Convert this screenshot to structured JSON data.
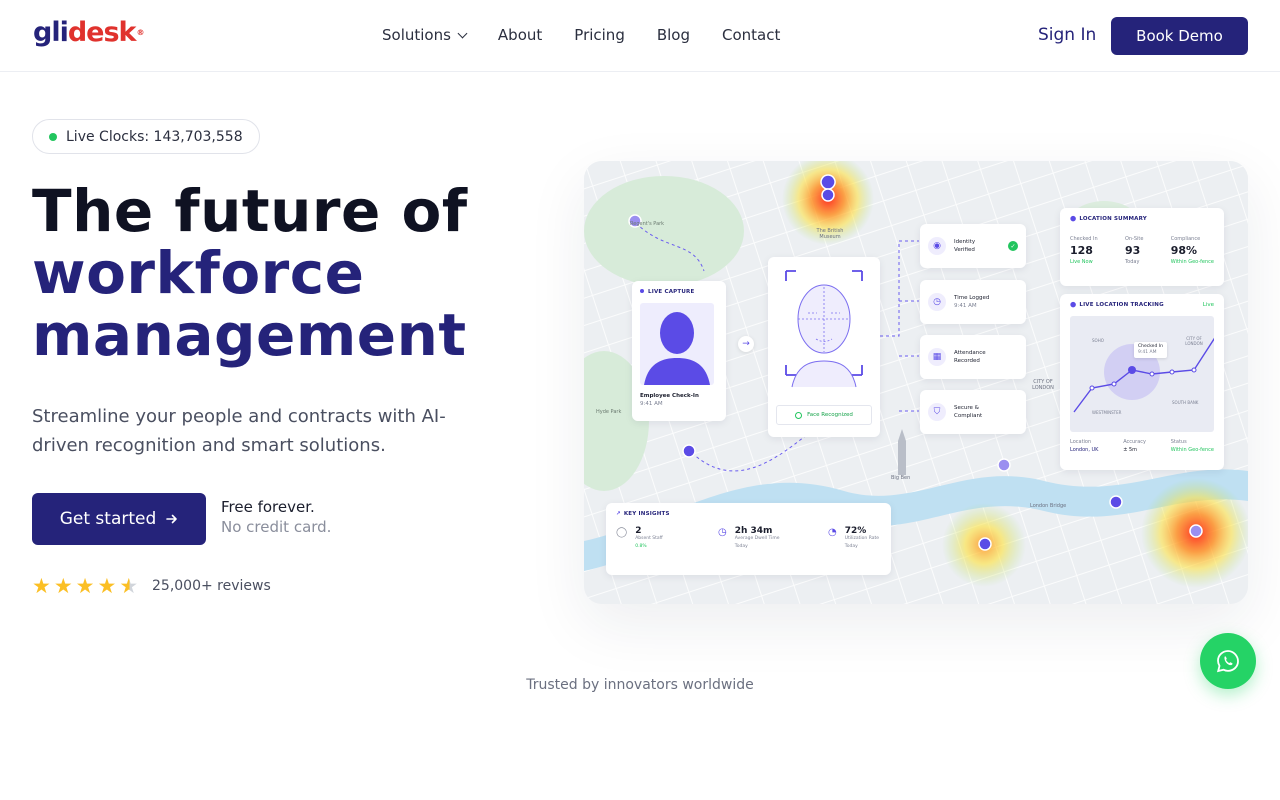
{
  "brand": {
    "part1": "gli",
    "part2": "desk",
    "mark": "®"
  },
  "nav": {
    "items": [
      {
        "label": "Solutions",
        "has_dropdown": true
      },
      {
        "label": "About"
      },
      {
        "label": "Pricing"
      },
      {
        "label": "Blog"
      },
      {
        "label": "Contact"
      }
    ],
    "sign_in": "Sign In",
    "book_demo": "Book Demo"
  },
  "hero": {
    "live_clocks": "Live Clocks: 143,703,558",
    "title_line1": "The future of",
    "title_line2": "workforce",
    "title_line3": "management",
    "subtitle": "Streamline your people and contracts with AI-driven recognition and smart solutions.",
    "cta_label": "Get started",
    "free_line1": "Free forever.",
    "free_line2": "No credit card.",
    "rating_stars": 4.5,
    "reviews": "25,000+ reviews"
  },
  "dashboard": {
    "map_labels": {
      "park": "Regent's Park",
      "museum": "The British Museum",
      "city": "CITY OF LONDON",
      "hyde": "Hyde Park",
      "bigben": "Big Ben",
      "bridge": "London Bridge"
    },
    "live_capture": {
      "title": "LIVE CAPTURE",
      "name": "Employee Check-In",
      "time": "9:41 AM"
    },
    "face": {
      "status": "Face Recognized"
    },
    "steps": [
      {
        "title": "Identity",
        "sub": "Verified"
      },
      {
        "title": "Time Logged",
        "sub": "9:41 AM"
      },
      {
        "title": "Attendance",
        "sub": "Recorded"
      },
      {
        "title": "Secure &",
        "sub": "Compliant"
      }
    ],
    "location_summary": {
      "title": "LOCATION SUMMARY",
      "stats": [
        {
          "label": "Checked In",
          "value": "128",
          "note": "Live Now"
        },
        {
          "label": "On-Site",
          "value": "93",
          "note": "Today"
        },
        {
          "label": "Compliance",
          "value": "98%",
          "note": "Within Geo-fence"
        }
      ]
    },
    "tracking": {
      "title": "LIVE LOCATION TRACKING",
      "live": "Live",
      "popup_title": "Checked In",
      "popup_time": "9:41 AM",
      "areas": [
        "SOHO",
        "CITY OF LONDON",
        "WESTMINSTER",
        "SOUTH BANK"
      ],
      "footer": [
        {
          "label": "Location",
          "value": "London, UK"
        },
        {
          "label": "Accuracy",
          "value": "± 5m"
        },
        {
          "label": "Status",
          "value": "Within Geo-fence"
        }
      ]
    },
    "insights": {
      "title": "KEY INSIGHTS",
      "items": [
        {
          "value": "2",
          "label": "Absent Staff",
          "note": "0.8%"
        },
        {
          "value": "2h 34m",
          "label": "Average Dwell Time",
          "note": "Today"
        },
        {
          "value": "72%",
          "label": "Utilization Rate",
          "note": "Today"
        }
      ]
    }
  },
  "trusted": "Trusted by innovators worldwide",
  "colors": {
    "brand": "#25237a",
    "accent": "#e0322d",
    "whatsapp": "#25d366"
  }
}
